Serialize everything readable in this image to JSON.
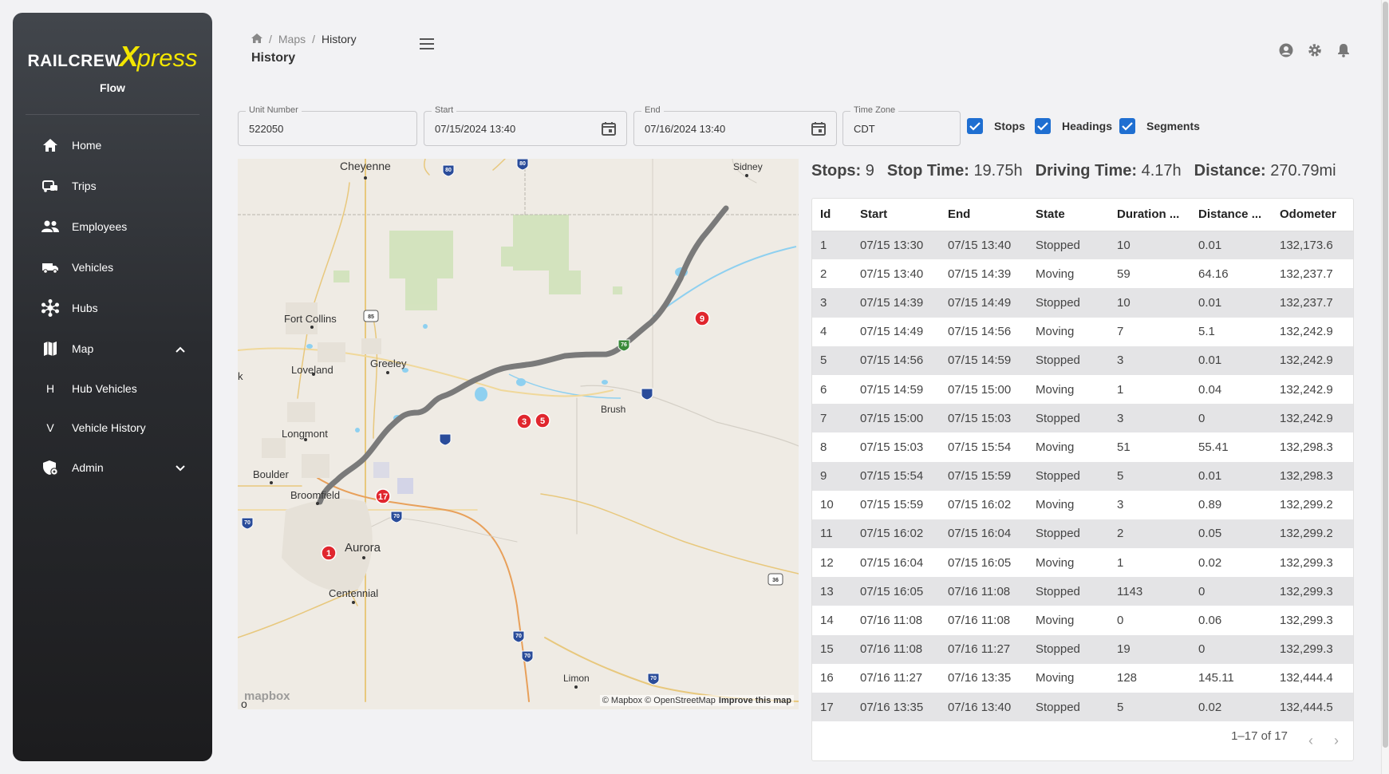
{
  "app": {
    "logo_prefix": "RAILCREW",
    "logo_x": "X",
    "logo_suffix": "press",
    "subtitle": "Flow"
  },
  "sidebar": {
    "items": [
      {
        "label": "Home",
        "icon": "home-icon"
      },
      {
        "label": "Trips",
        "icon": "trips-icon"
      },
      {
        "label": "Employees",
        "icon": "employees-icon"
      },
      {
        "label": "Vehicles",
        "icon": "vehicles-icon"
      },
      {
        "label": "Hubs",
        "icon": "hubs-icon"
      },
      {
        "label": "Map",
        "icon": "map-icon"
      },
      {
        "label": "Admin",
        "icon": "admin-icon"
      }
    ],
    "sub_items": [
      {
        "letter": "H",
        "label": "Hub Vehicles"
      },
      {
        "letter": "V",
        "label": "Vehicle History"
      }
    ]
  },
  "header": {
    "breadcrumb": {
      "level1": "Maps",
      "level2": "History"
    },
    "title": "History"
  },
  "filters": {
    "unit_number": {
      "label": "Unit Number",
      "value": "522050"
    },
    "start": {
      "label": "Start",
      "value": "07/15/2024 13:40"
    },
    "end": {
      "label": "End",
      "value": "07/16/2024 13:40"
    },
    "time_zone": {
      "label": "Time Zone",
      "value": "CDT"
    },
    "checkboxes": [
      {
        "label": "Stops",
        "checked": true
      },
      {
        "label": "Headings",
        "checked": true
      },
      {
        "label": "Segments",
        "checked": true
      }
    ]
  },
  "map": {
    "cities": [
      "Cheyenne",
      "Sidney",
      "Fort Collins",
      "Loveland",
      "Greeley",
      "Longmont",
      "Boulder",
      "Broomfield",
      "Aurora",
      "Centennial",
      "Limon",
      "Brush",
      "k",
      "o"
    ],
    "highway_shields": [
      "80",
      "80",
      "85",
      "76",
      "70",
      "70",
      "70",
      "70",
      "70",
      "36"
    ],
    "markers": [
      "1",
      "17",
      "3",
      "5",
      "9"
    ],
    "attribution": "© Mapbox © OpenStreetMap",
    "improve": "Improve this map",
    "logo": "mapbox",
    "route_color": "#6e6e6e",
    "marker_color": "#e0262e"
  },
  "stats": {
    "stops_label": "Stops:",
    "stops_value": "9",
    "stop_time_label": "Stop Time:",
    "stop_time_value": "19.75h",
    "driving_time_label": "Driving Time:",
    "driving_time_value": "4.17h",
    "distance_label": "Distance:",
    "distance_value": "270.79mi"
  },
  "table": {
    "columns": [
      "Id",
      "Start",
      "End",
      "State",
      "Duration ...",
      "Distance ...",
      "Odometer"
    ],
    "rows": [
      [
        "1",
        "07/15 13:30",
        "07/15 13:40",
        "Stopped",
        "10",
        "0.01",
        "132,173.6"
      ],
      [
        "2",
        "07/15 13:40",
        "07/15 14:39",
        "Moving",
        "59",
        "64.16",
        "132,237.7"
      ],
      [
        "3",
        "07/15 14:39",
        "07/15 14:49",
        "Stopped",
        "10",
        "0.01",
        "132,237.7"
      ],
      [
        "4",
        "07/15 14:49",
        "07/15 14:56",
        "Moving",
        "7",
        "5.1",
        "132,242.9"
      ],
      [
        "5",
        "07/15 14:56",
        "07/15 14:59",
        "Stopped",
        "3",
        "0.01",
        "132,242.9"
      ],
      [
        "6",
        "07/15 14:59",
        "07/15 15:00",
        "Moving",
        "1",
        "0.04",
        "132,242.9"
      ],
      [
        "7",
        "07/15 15:00",
        "07/15 15:03",
        "Stopped",
        "3",
        "0",
        "132,242.9"
      ],
      [
        "8",
        "07/15 15:03",
        "07/15 15:54",
        "Moving",
        "51",
        "55.41",
        "132,298.3"
      ],
      [
        "9",
        "07/15 15:54",
        "07/15 15:59",
        "Stopped",
        "5",
        "0.01",
        "132,298.3"
      ],
      [
        "10",
        "07/15 15:59",
        "07/15 16:02",
        "Moving",
        "3",
        "0.89",
        "132,299.2"
      ],
      [
        "11",
        "07/15 16:02",
        "07/15 16:04",
        "Stopped",
        "2",
        "0.05",
        "132,299.2"
      ],
      [
        "12",
        "07/15 16:04",
        "07/15 16:05",
        "Moving",
        "1",
        "0.02",
        "132,299.3"
      ],
      [
        "13",
        "07/15 16:05",
        "07/16 11:08",
        "Stopped",
        "1143",
        "0",
        "132,299.3"
      ],
      [
        "14",
        "07/16 11:08",
        "07/16 11:08",
        "Moving",
        "0",
        "0.06",
        "132,299.3"
      ],
      [
        "15",
        "07/16 11:08",
        "07/16 11:27",
        "Stopped",
        "19",
        "0",
        "132,299.3"
      ],
      [
        "16",
        "07/16 11:27",
        "07/16 13:35",
        "Moving",
        "128",
        "145.11",
        "132,444.4"
      ],
      [
        "17",
        "07/16 13:35",
        "07/16 13:40",
        "Stopped",
        "5",
        "0.02",
        "132,444.5"
      ]
    ],
    "pagination": "1–17 of 17"
  }
}
